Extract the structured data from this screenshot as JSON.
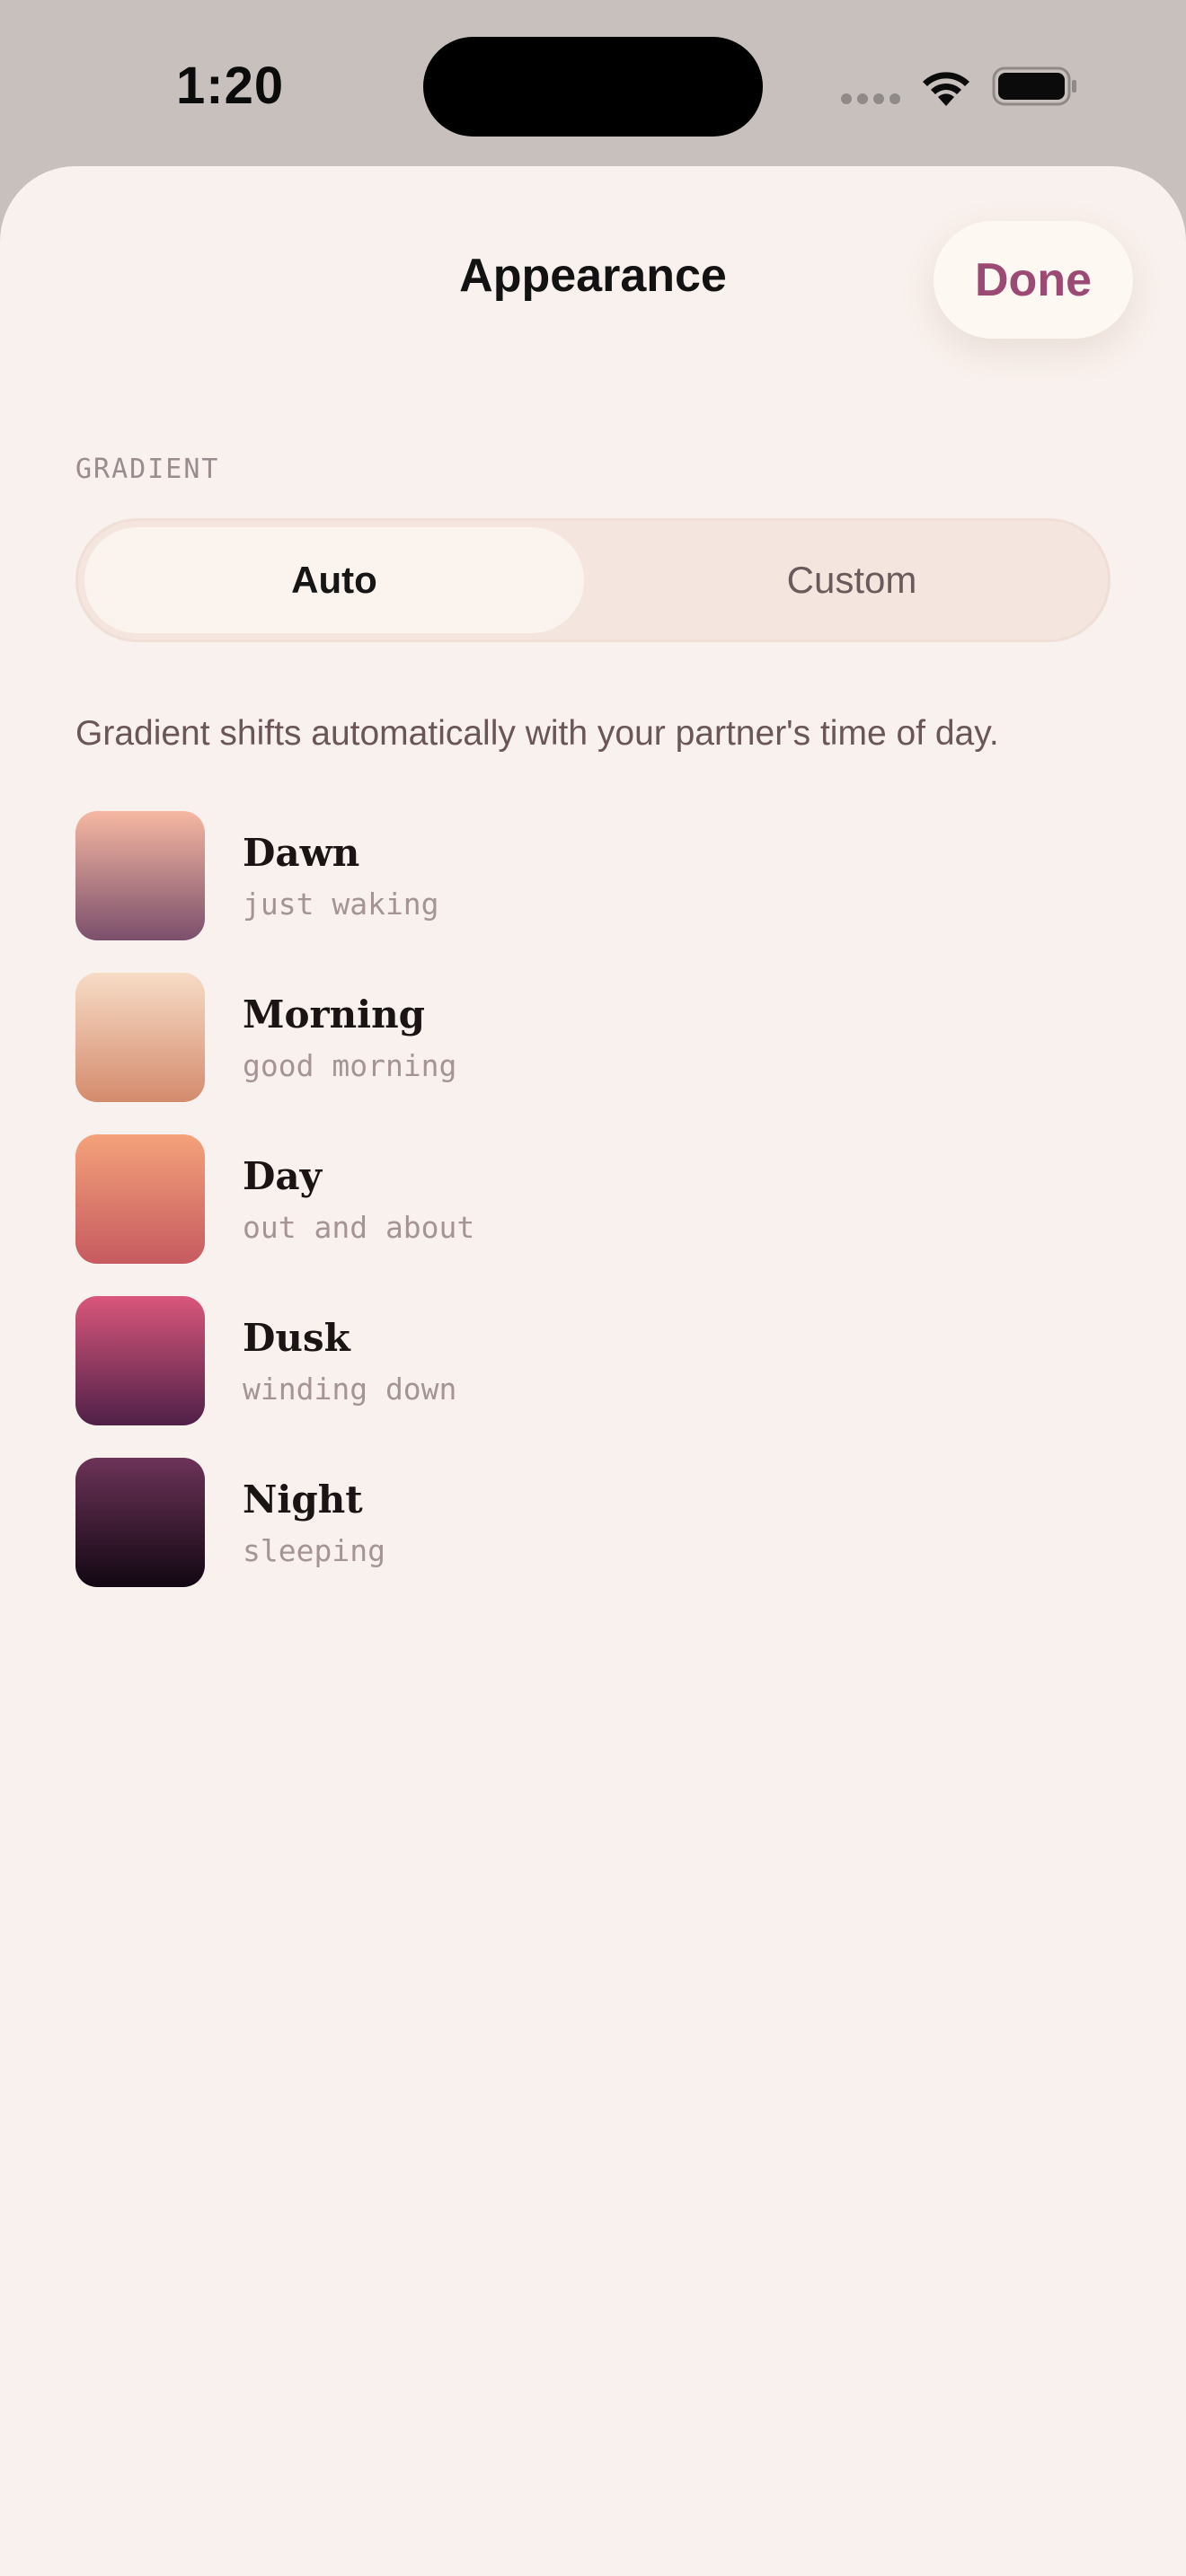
{
  "status_bar": {
    "time": "1:20"
  },
  "header": {
    "title": "Appearance",
    "done_label": "Done"
  },
  "gradient": {
    "section_label": "GRADIENT",
    "segments": [
      {
        "label": "Auto",
        "selected": true
      },
      {
        "label": "Custom",
        "selected": false
      }
    ],
    "description": "Gradient shifts automatically with your partner's time of day.",
    "items": [
      {
        "name": "Dawn",
        "subtitle": "just waking",
        "top_color": "#f6b8a2",
        "bottom_color": "#7b4f6c"
      },
      {
        "name": "Morning",
        "subtitle": "good morning",
        "top_color": "#f7dcc6",
        "bottom_color": "#d48b6d"
      },
      {
        "name": "Day",
        "subtitle": "out and about",
        "top_color": "#f4a27a",
        "bottom_color": "#c65a60"
      },
      {
        "name": "Dusk",
        "subtitle": "winding down",
        "top_color": "#d9577b",
        "bottom_color": "#4f2048"
      },
      {
        "name": "Night",
        "subtitle": "sleeping",
        "top_color": "#6c3358",
        "bottom_color": "#120712"
      }
    ]
  },
  "colors": {
    "accent": "#9b4a73",
    "sheet_background": "#f9f1ed"
  }
}
